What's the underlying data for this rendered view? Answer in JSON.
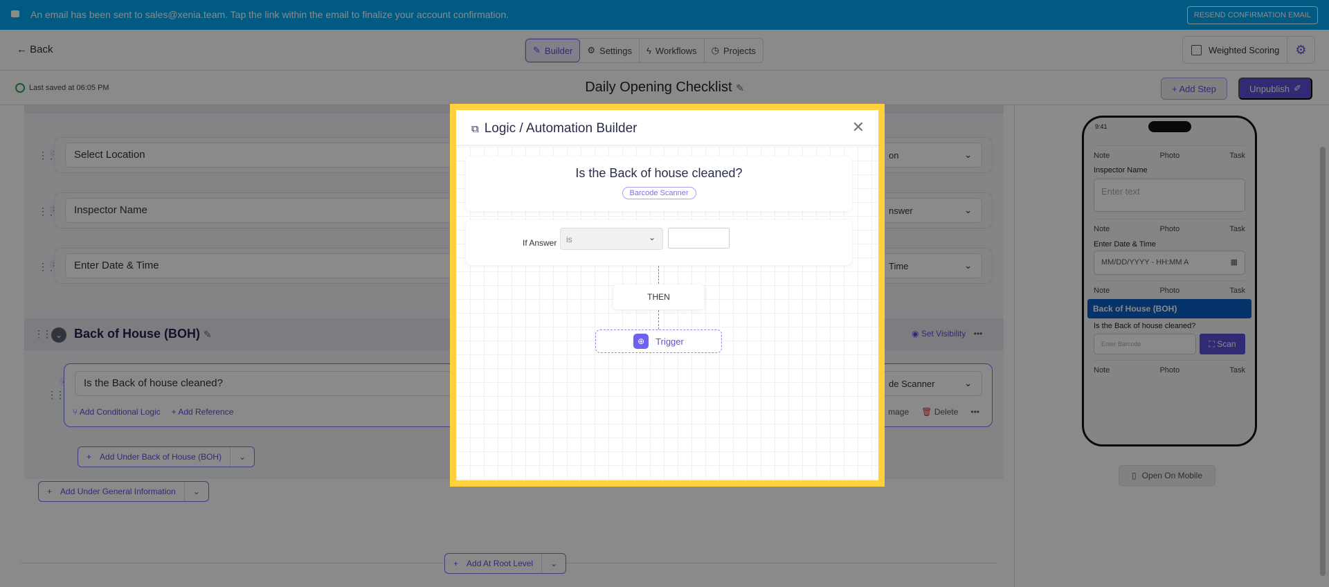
{
  "banner": {
    "message": "An email has been sent to sales@xenia.team. Tap the link within the email to finalize your account confirmation.",
    "resend": "RESEND CONFIRMATION EMAIL"
  },
  "topbar": {
    "back": "Back",
    "tabs": [
      "Builder",
      "Settings",
      "Workflows",
      "Projects"
    ],
    "weighted_scoring": "Weighted Scoring"
  },
  "header": {
    "last_saved": "Last saved at 06:05 PM",
    "title": "Daily Opening Checklist",
    "add_step": "+ Add Step",
    "unpublish": "Unpublish"
  },
  "builder": {
    "questions": [
      {
        "num": "1",
        "title": "Select Location",
        "type": "on"
      },
      {
        "num": "2",
        "title": "Inspector Name",
        "type": "nswer"
      },
      {
        "num": "3",
        "title": "Enter Date & Time",
        "type": "Time"
      }
    ],
    "section": {
      "title": "Back of House (BOH)",
      "set_visibility": "Set Visibility"
    },
    "q4": {
      "num": "4",
      "title": "Is the Back of house cleaned?",
      "type": "de Scanner",
      "add_logic": "Add Conditional Logic",
      "add_reference": "Add Reference",
      "image": "mage",
      "delete": "Delete"
    },
    "add_under_boh": "Add Under Back of House (BOH)",
    "add_under_gi": "Add Under General Information",
    "add_root": "Add At Root Level"
  },
  "preview": {
    "time": "9:41",
    "note": "Note",
    "photo": "Photo",
    "task": "Task",
    "inspector_label": "Inspector Name",
    "inspector_ph": "Enter text",
    "date_label": "Enter Date & Time",
    "date_ph": "MM/DD/YYYY - HH:MM A",
    "section": "Back of House (BOH)",
    "question": "Is the Back of house cleaned?",
    "barcode_ph": "Enter Barcode",
    "scan": "Scan",
    "open_mobile": "Open On Mobile"
  },
  "modal": {
    "title": "Logic / Automation Builder",
    "question": "Is the Back of house cleaned?",
    "type_chip": "Barcode Scanner",
    "if_answer": "If Answer",
    "operator": "is",
    "value": "",
    "then": "THEN",
    "trigger": "Trigger"
  }
}
